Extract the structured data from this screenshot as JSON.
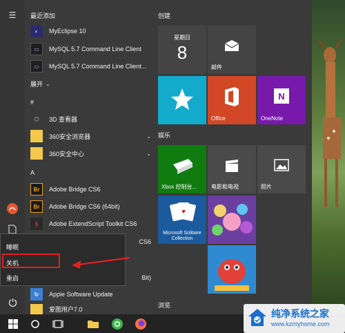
{
  "colors": {
    "tile_blue": "#1f4e79",
    "tile_teal": "#14aacc",
    "tile_orange": "#d24726",
    "tile_purple": "#7719aa",
    "tile_green": "#107c10",
    "tile_dark": "#4a4a4a",
    "highlight_red": "#e32020"
  },
  "applist": {
    "recent_header": "最近添加",
    "recent": [
      {
        "label": "MyEclipse 10",
        "icon": "myeclipse-icon"
      },
      {
        "label": "MySQL 5.7 Command Line Client",
        "icon": "mysql-terminal-icon"
      },
      {
        "label": "MySQL 5.7 Command Line Client...",
        "icon": "mysql-terminal-icon"
      }
    ],
    "expand_label": "展开",
    "hash_header": "#",
    "hash_items": [
      {
        "label": "3D 查看器",
        "icon": "cube-icon"
      },
      {
        "label": "360安全浏览器",
        "icon": "folder-icon"
      },
      {
        "label": "360安全中心",
        "icon": "folder-icon"
      }
    ],
    "a_header": "A",
    "a_items": [
      {
        "label": "Adobe Bridge CS6",
        "icon_text": "Br"
      },
      {
        "label": "Adobe Bridge CS6 (64bit)",
        "icon_text": "Br"
      },
      {
        "label": "Adobe ExtendScript Toolkit CS6",
        "icon": "extendscript-icon"
      },
      {
        "label": "CS6",
        "icon": "adobe-icon"
      },
      {
        "label": "Bit)",
        "icon": "adobe-icon"
      },
      {
        "label": "Apple Software Update",
        "icon": "apple-update-icon"
      },
      {
        "label": "爱图用户7.0",
        "icon": "folder-icon"
      }
    ]
  },
  "power_menu": {
    "sleep": "睡眠",
    "shutdown": "关机",
    "restart": "重启"
  },
  "tiles": {
    "create_label": "创建",
    "entertainment_label": "娱乐",
    "browse_label": "浏览",
    "calendar_weekday": "星期日",
    "calendar_day": "8",
    "mail": "邮件",
    "office": "Office",
    "onenote": "OneNote",
    "xbox": "Xbox 控制台...",
    "movies": "电影和电视",
    "photos": "照片",
    "solitaire": "Microsoft Solitaire Collection"
  },
  "watermark": {
    "title": "纯净系统之家",
    "url": "www.kzmyhome.com"
  }
}
